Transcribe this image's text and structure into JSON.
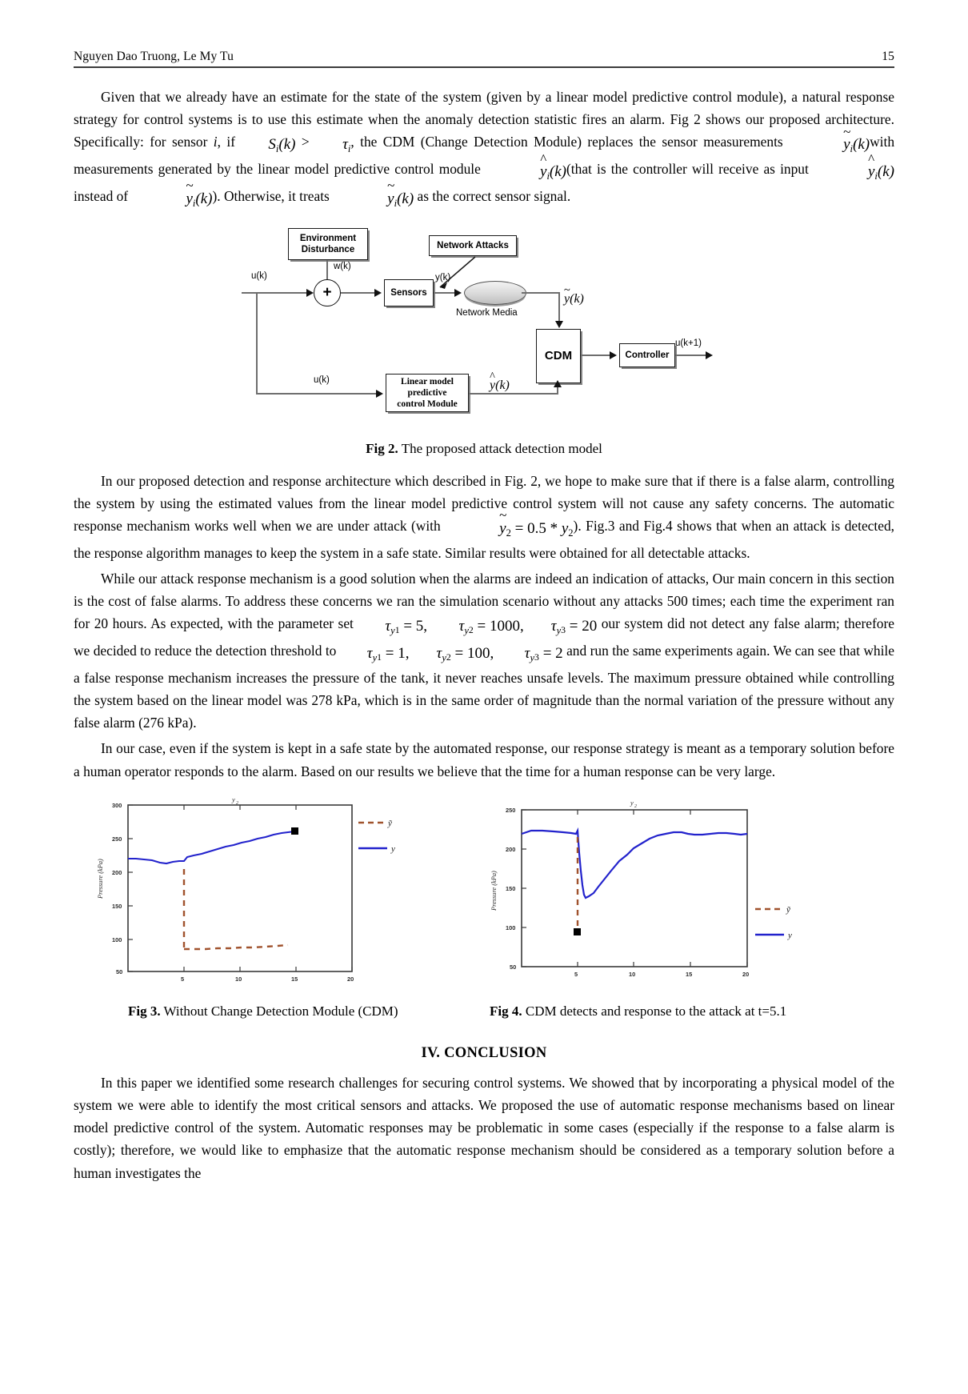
{
  "header": {
    "authors": "Nguyen Dao Truong, Le My Tu",
    "page_number": "15"
  },
  "paragraphs": {
    "p1_a": "Given that we already have an estimate for the state of the system (given by a linear model predictive control module), a natural response strategy for control systems is to use this estimate when the anomaly detection statistic fires an alarm. Fig 2 shows our proposed architecture. Specifically: for sensor ",
    "p1_i": "i",
    "p1_b": ", if ",
    "p1_math_S": "S",
    "p1_math_S_sub": "i",
    "p1_math_S_arg": "(k)",
    "p1_gt": " > ",
    "p1_math_tau": "τ",
    "p1_math_tau_sub": "i",
    "p1_c": ", the CDM (Change Detection Module) replaces the sensor measurements ",
    "p1_ytilde1": "y",
    "p1_ytilde1_sub": "i",
    "p1_ytilde1_arg": "(k)",
    "p1_d": "with measurements generated by the linear model predictive control module ",
    "p1_yhat1": "y",
    "p1_yhat1_sub": "i",
    "p1_yhat1_arg": "(k)",
    "p1_e": "(that is the controller will receive as input ",
    "p1_yhat2": "y",
    "p1_yhat2_sub": "i",
    "p1_yhat2_arg": "(k)",
    "p1_f": " instead of ",
    "p1_ytilde2": "y",
    "p1_ytilde2_sub": "i",
    "p1_ytilde2_arg": "(k)",
    "p1_g": "). Otherwise, it treats ",
    "p1_ytilde3": "y",
    "p1_ytilde3_sub": "i",
    "p1_ytilde3_arg": "(k)",
    "p1_h": " as the correct sensor signal.",
    "p2_a": "In our proposed detection and response architecture which described in Fig. 2, we hope to make sure that if there is a false alarm, controlling the system by using the estimated values from the linear model predictive control system will not cause any safety concerns. The automatic response mechanism works well when we are under attack (with ",
    "p2_eq_y": "y",
    "p2_eq_y_sub": "2",
    "p2_eq_mid": " = 0.5 * ",
    "p2_eq_y2": "y",
    "p2_eq_y2_sub": "2",
    "p2_b": "). Fig.3 and Fig.4 shows that when an attack is detected, the response algorithm manages to keep the system in a safe state. Similar results were obtained for all detectable attacks.",
    "p3_a": "While our attack response mechanism is a good solution when the alarms are indeed an indication of attacks, Our main concern in this section is the cost of false alarms. To address these concerns we ran the simulation scenario without any attacks 500 times; each time the experiment ran for 20 hours. As expected, with the parameter set ",
    "p3_t1_sym": "τ",
    "p3_t1_sub": "y",
    "p3_t1_subsub": "1",
    "p3_t1_val": " = 5,",
    "p3_t2_sym": "τ",
    "p3_t2_sub": "y",
    "p3_t2_subsub": "2",
    "p3_t2_val": " = 1000,",
    "p3_t3_sym": "τ",
    "p3_t3_sub": "y",
    "p3_t3_subsub": "3",
    "p3_t3_val": " = 20",
    "p3_b": " our system did not detect any false alarm; therefore we decided to reduce the detection threshold to ",
    "p3_t4_sym": "τ",
    "p3_t4_sub": "y",
    "p3_t4_subsub": "1",
    "p3_t4_val": " = 1,",
    "p3_t5_sym": "τ",
    "p3_t5_sub": "y",
    "p3_t5_subsub": "2",
    "p3_t5_val": " = 100,",
    "p3_t6_sym": "τ",
    "p3_t6_sub": "y",
    "p3_t6_subsub": "3",
    "p3_t6_val": " = 2",
    "p3_c": " and run the same experiments again. We can see that while a false response mechanism increases the pressure of the tank, it never reaches unsafe levels. The maximum pressure obtained while controlling the system based on the linear model was 278 kPa, which is in the same order of magnitude than the normal variation of the pressure without any false alarm (276 kPa).",
    "p4": "In our case, even if the system is kept in a safe state by the automated response, our response strategy is meant as a temporary solution before a human operator responds to the alarm. Based on our results we believe that the time for a human response can be very large.",
    "p5": "In this paper we identified some research challenges for securing control systems. We showed that by incorporating a physical model of the system we were able to identify the most critical sensors and attacks. We proposed the use of automatic response mechanisms based on linear model predictive control of the system. Automatic responses may be problematic in some cases (especially if the response to a false alarm is costly); therefore, we would like to emphasize that the automatic response mechanism should be considered as a temporary solution before a human investigates the"
  },
  "figure2": {
    "caption_label": "Fig 2.",
    "caption_text": " The proposed attack detection model",
    "boxes": {
      "environment_disturbance": "Environment\nDisturbance",
      "network_attacks": "Network Attacks",
      "sensors": "Sensors",
      "cdm": "CDM",
      "controller": "Controller",
      "linear_model": "Linear model\npredictive\ncontrol Module"
    },
    "labels": {
      "u_k_in": "u(k)",
      "w_k": "w(k)",
      "y_k": "y(k)",
      "network_media": "Network Media",
      "y_tilde": "y",
      "y_tilde_arg": "(k)",
      "y_hat": "y",
      "y_hat_arg": "(k)",
      "u_k_lower": "u(k)",
      "u_k_plus_1": "u(k+1)",
      "summer": "+"
    }
  },
  "figure3": {
    "caption_label": "Fig 3.",
    "caption_text": " Without Change Detection Module (CDM)"
  },
  "figure4": {
    "caption_label": "Fig 4.",
    "caption_text": " CDM detects and response to the attack at t=5.1"
  },
  "conclusion_title": "IV. CONCLUSION",
  "chart_data": [
    {
      "type": "line",
      "title": "y2",
      "name": "Fig 3 - Without Change Detection Module (CDM)",
      "xlabel": "",
      "ylabel": "Pressure (kPa)",
      "xlim": [
        0,
        20
      ],
      "ylim": [
        50,
        300
      ],
      "xticks": [
        5,
        10,
        15,
        20
      ],
      "yticks": [
        50,
        100,
        150,
        200,
        250,
        300
      ],
      "ytick_labels": [
        "50",
        "100",
        "150",
        "200",
        "250",
        "300"
      ],
      "grid": false,
      "legend_position": "top-right-outside",
      "series": [
        {
          "name": "y-tilde",
          "label": "ŷ",
          "style": "dashed",
          "color": "#a0522d",
          "x": [
            0,
            4.95,
            5.0,
            5.05,
            5.2,
            6,
            7,
            8,
            9,
            10,
            11,
            12,
            13,
            14,
            15,
            16
          ],
          "y": [
            null,
            218,
            200,
            150,
            88,
            87,
            87,
            88,
            88,
            89,
            89,
            90,
            90,
            91,
            91,
            92
          ]
        },
        {
          "name": "y",
          "label": "y",
          "style": "solid",
          "color": "#2222cc",
          "x": [
            0,
            1,
            2,
            3,
            3.6,
            4.2,
            5,
            5.3,
            6,
            7,
            8,
            9,
            10,
            11,
            12,
            13,
            14,
            15,
            15.6
          ],
          "y": [
            220,
            220,
            219,
            216,
            215,
            217,
            218,
            224,
            226,
            229,
            232,
            234,
            237,
            239,
            241,
            243,
            245,
            247,
            248
          ]
        }
      ],
      "markers": [
        {
          "x": 15.6,
          "y": 248,
          "shape": "square",
          "color": "#000000"
        }
      ]
    },
    {
      "type": "line",
      "title": "y2",
      "name": "Fig 4 - CDM detects and response to the attack at t=5.1",
      "xlabel": "",
      "ylabel": "Pressure (kPa)",
      "xlim": [
        0,
        20
      ],
      "ylim": [
        50,
        250
      ],
      "xticks": [
        5,
        10,
        15,
        20
      ],
      "yticks": [
        50,
        100,
        150,
        200,
        250
      ],
      "ytick_labels": [
        "50",
        "100",
        "150",
        "200",
        "250"
      ],
      "grid": false,
      "legend_position": "bottom-right-outside",
      "series": [
        {
          "name": "y-tilde",
          "label": "ŷ",
          "style": "dashed",
          "color": "#a0522d",
          "x": [
            5.0,
            5.0,
            5.0,
            5.0,
            5.0
          ],
          "y": [
            212,
            190,
            160,
            130,
            92
          ]
        },
        {
          "name": "y",
          "label": "y",
          "style": "solid",
          "color": "#2222cc",
          "x": [
            0,
            1,
            2,
            3,
            4,
            4.9,
            5.0,
            5.1,
            5.3,
            5.6,
            6,
            6.5,
            7,
            8,
            9,
            10,
            11,
            12,
            13,
            14,
            15,
            16,
            17,
            18,
            19,
            20
          ],
          "y": [
            219,
            221,
            221,
            220,
            219,
            218,
            222,
            186,
            160,
            163,
            175,
            188,
            196,
            207,
            213,
            218,
            221,
            222,
            220,
            219,
            219,
            220,
            221,
            220,
            219,
            220
          ]
        }
      ],
      "markers": [
        {
          "x": 5.05,
          "y": 90,
          "shape": "square",
          "color": "#000000"
        }
      ]
    }
  ]
}
